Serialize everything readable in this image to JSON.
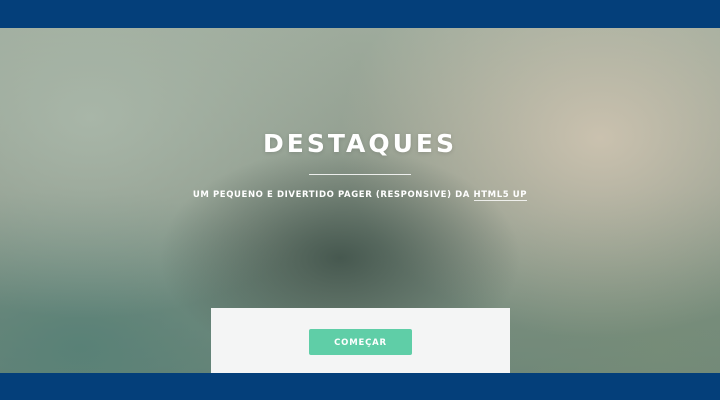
{
  "hero": {
    "title": "DESTAQUES",
    "subtitle_prefix": "UM PEQUENO E DIVERTIDO PAGER (RESPONSIVE) DA ",
    "subtitle_link": "HTML5 UP",
    "cta_label": "COMEÇAR"
  },
  "colors": {
    "frame": "#043f7a",
    "accent": "#5fcea7",
    "panel": "#f4f5f5"
  }
}
